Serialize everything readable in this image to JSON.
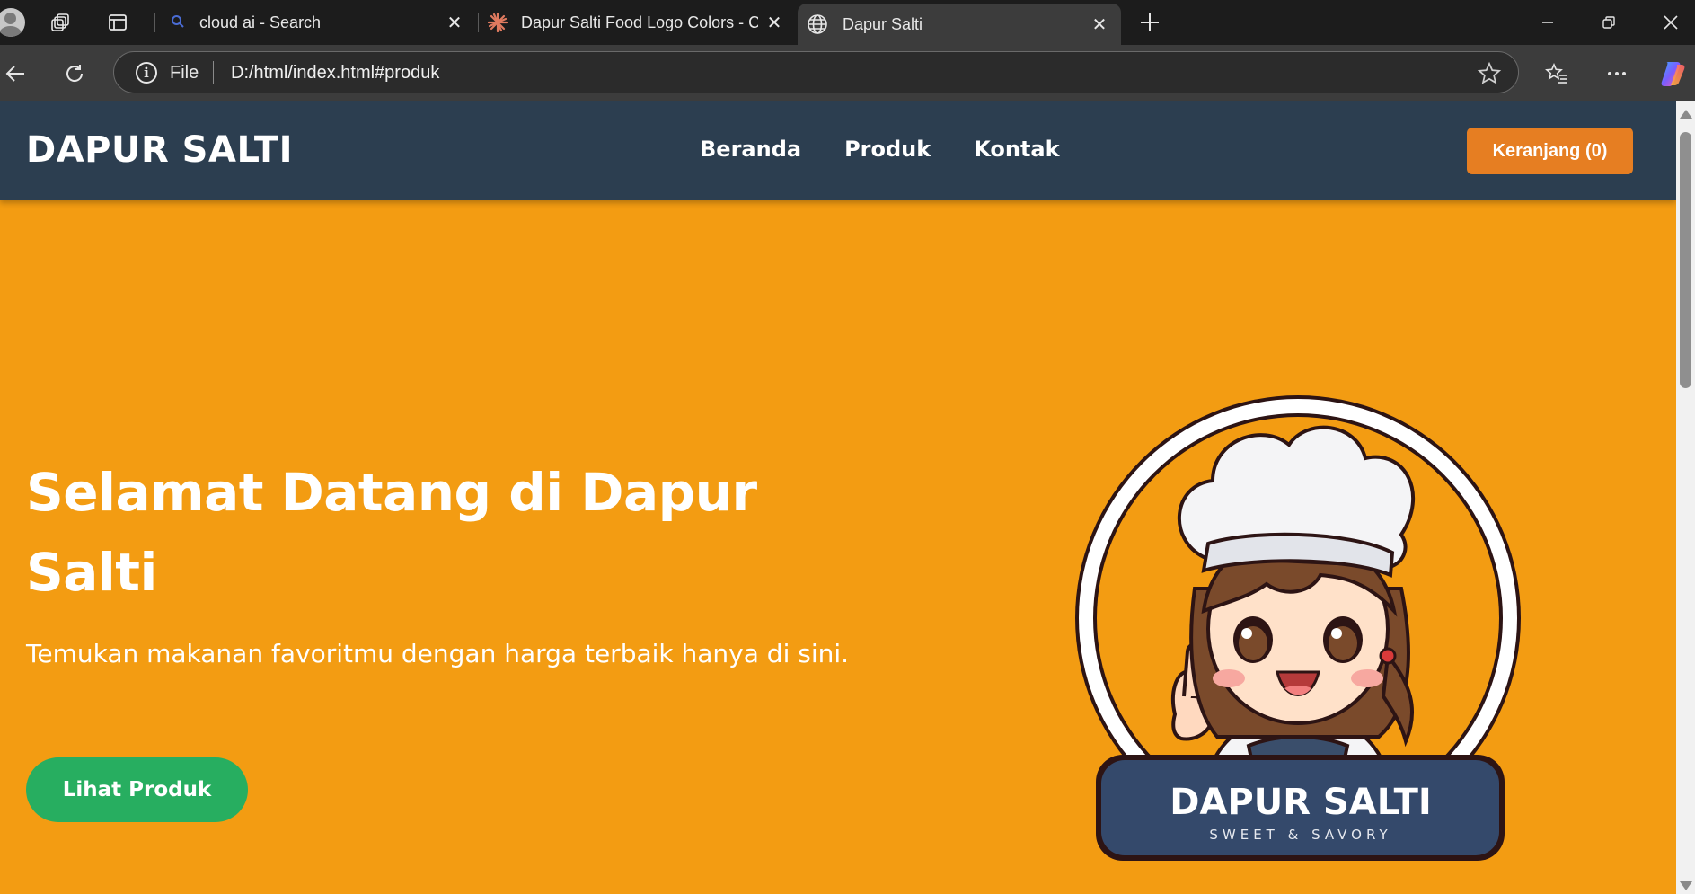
{
  "browser": {
    "tabs": [
      {
        "title": "cloud ai - Search",
        "icon": "search-icon",
        "active": false
      },
      {
        "title": "Dapur Salti Food Logo Colors - Cl",
        "icon": "claude-sparkle-icon",
        "active": false
      },
      {
        "title": "Dapur Salti",
        "icon": "globe-icon",
        "active": true
      }
    ],
    "address": {
      "scheme_label": "File",
      "url": "D:/html/index.html#produk"
    }
  },
  "site": {
    "brand": "DAPUR SALTI",
    "nav": [
      "Beranda",
      "Produk",
      "Kontak"
    ],
    "cart_label": "Keranjang (0)",
    "hero": {
      "title": "Selamat Datang di Dapur Salti",
      "subtitle": "Temukan makanan favoritmu dengan harga terbaik hanya di sini.",
      "cta": "Lihat Produk"
    },
    "logo": {
      "name": "DAPUR SALTI",
      "tagline": "SWEET & SAVORY"
    }
  },
  "colors": {
    "header": "#2c3e50",
    "hero_bg": "#f39c12",
    "cart": "#e67e22",
    "cta": "#27ae60"
  }
}
